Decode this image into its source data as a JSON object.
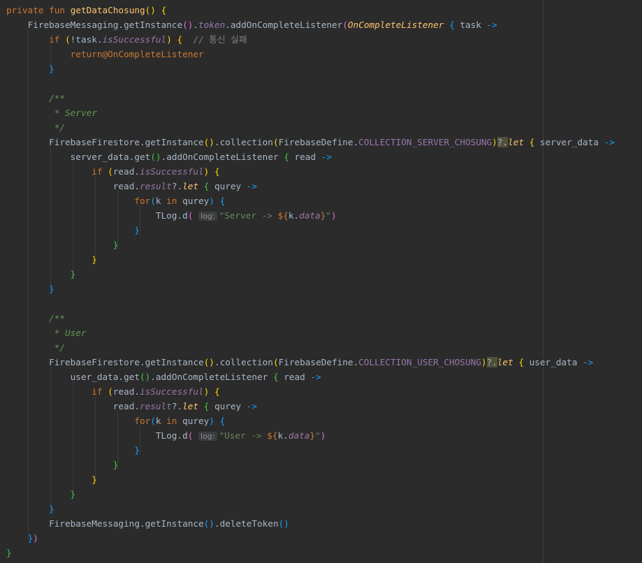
{
  "code": {
    "kw_private": "private",
    "kw_fun": "fun",
    "fn_name": "getDataChosung",
    "fm": "FirebaseMessaging",
    "get_instance": "getInstance",
    "token": "token",
    "add_listener": "addOnCompleteListener",
    "listener_class": "OnCompleteListener",
    "task": "task",
    "arrow": "->",
    "kw_if": "if",
    "not_task": "!task.",
    "is_successful": "isSuccessful",
    "comment_fail": "// 통신 실패",
    "return_label": "return@OnCompleteListener",
    "doc_open": "/**",
    "doc_server": " * Server",
    "doc_user": " * User",
    "doc_close": " */",
    "ff": "FirebaseFirestore",
    "collection": "collection",
    "fd": "FirebaseDefine.",
    "coll_server": "COLLECTION_SERVER_CHOSUNG",
    "coll_user": "COLLECTION_USER_CHOSUNG",
    "safe_call": "?.",
    "kw_let": "let",
    "server_data": "server_data",
    "user_data": "user_data",
    "get": "get",
    "read": "read",
    "result": "result",
    "qurey": "qurey",
    "kw_for": "for",
    "k": "k",
    "kw_in": "in",
    "tlog": "TLog.d",
    "hint_log": "log:",
    "str_server": "\"Server -> ",
    "str_user": "\"User -> ",
    "tpl_open": "${",
    "data_prop": "data",
    "str_end": "\"",
    "delete_token": "deleteToken"
  }
}
